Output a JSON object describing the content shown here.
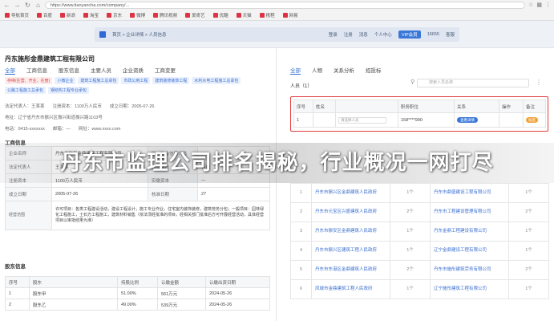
{
  "browser": {
    "url": "https://www.tianyancha.com/company/...",
    "bookmarks": [
      "导航首页",
      "百度",
      "新浪",
      "淘宝",
      "京东",
      "微博",
      "腾讯视频",
      "爱奇艺",
      "优酷",
      "天猫",
      "携程",
      "网易"
    ]
  },
  "site_header": {
    "breadcrumb": "首页 > 企业详情 > 人员信息",
    "links": [
      "登录",
      "注册",
      "消息",
      "个人中心"
    ],
    "pill": "VIP会员",
    "phone": "16655",
    "extra": "客服"
  },
  "company": {
    "name": "丹东施彤金鼎建筑工程有限公司",
    "tabs": [
      "全部",
      "工商信息",
      "股东信息",
      "主要人员",
      "企业资质",
      "工商变更"
    ],
    "active_tab": "全部",
    "tags": [
      {
        "text": "存续(在营、开业、在册)",
        "tone": "red"
      },
      {
        "text": "小微企业",
        "tone": "blue"
      },
      {
        "text": "建筑工程施工总承包",
        "tone": "blue"
      },
      {
        "text": "市政公用工程",
        "tone": "blue"
      },
      {
        "text": "建筑装修装饰工程",
        "tone": "blue"
      },
      {
        "text": "水利水电工程施工总承包",
        "tone": "blue"
      },
      {
        "text": "公路工程施工总承包",
        "tone": "blue"
      },
      {
        "text": "钢结构工程专业承包",
        "tone": "blue"
      }
    ],
    "info_row1": [
      "法定代表人：王某某",
      "注册资本：1100万人民币",
      "成立日期：2005-07-26"
    ],
    "info_row2": "地址：辽宁省丹东市振兴区振兴街道振兴路1103号",
    "info_row3": [
      "电话：0415-xxxxxxx",
      "邮箱：—",
      "网址：www.xxxx.com"
    ]
  },
  "basic": {
    "section_title": "工商信息",
    "rows": [
      {
        "k1": "企业名称",
        "v1": "丹东市施彤金鼎建筑工程有限公司",
        "k2": "统一社会信用代码",
        "v2": "—"
      },
      {
        "k1": "法定代表人",
        "v1": "王某某",
        "k2": "经营状态",
        "v2": "存续"
      },
      {
        "k1": "注册资本",
        "v1": "1100万人民币",
        "k2": "实缴资本",
        "v2": "—"
      },
      {
        "k1": "成立日期",
        "v1": "2005-07-26",
        "k2": "核准日期",
        "v2": "27"
      }
    ],
    "scope_label": "经营范围",
    "scope_text": "许可项目：各类工程建设活动，建设工程设计，施工专业作业，住宅室内装饰装修，建筑劳务分包；一般项目：园林绿化工程施工，土石方工程施工，建筑材料销售（依法须经批准的项目，经相关部门批准后方可开展经营活动，具体经营项目以审批结果为准）"
  },
  "people": {
    "section_title": "股东信息",
    "headers": [
      "序号",
      "股东",
      "持股比例",
      "认缴金额",
      "认缴出资日期"
    ],
    "rows": [
      {
        "no": "1",
        "name": "股东甲",
        "pct": "51.00%",
        "amt": "561万元",
        "date": "2024-05-26"
      },
      {
        "no": "2",
        "name": "股东乙",
        "pct": "49.00%",
        "amt": "539万元",
        "date": "2024-05-26"
      }
    ]
  },
  "right": {
    "tabs": [
      "全部",
      "人物",
      "关系分析",
      "招投标"
    ],
    "active_tab": "全部",
    "list_title": "人员（1）",
    "search_placeholder": "搜索人员名称",
    "table_headers": [
      "序号",
      "姓名",
      "",
      "职务职位",
      "关系",
      "操作",
      "备注"
    ],
    "row": {
      "no": "1",
      "select": "请选择人员",
      "phone": "158****990",
      "btn": "查看详情",
      "badge": "标签"
    },
    "list": [
      {
        "no": "1",
        "a": "丹东市振兴区金鼎建筑人民政府",
        "b": "1个",
        "c": "丹东市鼎盛建设工程有限公司",
        "d": "1个"
      },
      {
        "no": "2",
        "a": "丹东市元宝区兴盛建筑人民政府",
        "b": "2个",
        "c": "丹东市工程建设管理有限公司",
        "d": "2个"
      },
      {
        "no": "3",
        "a": "丹东市振安区金鼎建筑人民政府",
        "b": "1个",
        "c": "丹东金鼎工程建设有限公司",
        "d": "1个"
      },
      {
        "no": "4",
        "a": "丹东市振兴区建筑工程人民政府",
        "b": "1个",
        "c": "辽宁金鼎建设工程有限公司",
        "d": "1个"
      },
      {
        "no": "5",
        "a": "丹东市东港区金鼎建筑人民政府",
        "b": "2个",
        "c": "丹东市施彤建筑劳务有限公司",
        "d": "2个"
      },
      {
        "no": "6",
        "a": "凤城市金鼎建筑工程人民政府",
        "b": "1个",
        "c": "辽宁施彤建筑工程有限公司",
        "d": "1个"
      }
    ]
  },
  "overlay": {
    "title": "丹东市监理公司排名揭秘，行业概况一网打尽"
  }
}
